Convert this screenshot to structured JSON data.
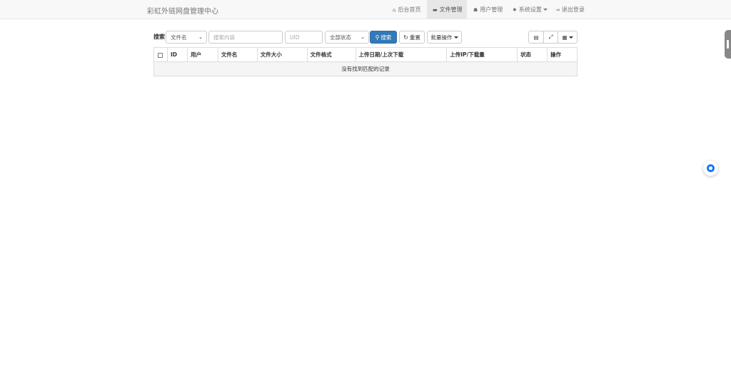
{
  "navbar": {
    "brand": "彩虹外链网盘管理中心",
    "items": [
      {
        "label": "后台首页",
        "icon": "home-icon",
        "active": false
      },
      {
        "label": "文件管理",
        "icon": "folder-icon",
        "active": true
      },
      {
        "label": "用户管理",
        "icon": "users-icon",
        "active": false
      },
      {
        "label": "系统设置",
        "icon": "gear-icon",
        "active": false,
        "dropdown": true
      },
      {
        "label": "退出登录",
        "icon": "sign-out-icon",
        "active": false
      }
    ]
  },
  "toolbar": {
    "search_label": "搜索",
    "field_select": "文件名",
    "keyword_placeholder": "搜索内容",
    "uid_placeholder": "UID",
    "status_select": "全部状态",
    "search_button": "搜索",
    "reset_button": "重置",
    "batch_button": "批量操作"
  },
  "table": {
    "columns": [
      "ID",
      "用户",
      "文件名",
      "文件大小",
      "文件格式",
      "上传日期/上次下载",
      "上传IP/下载量",
      "状态",
      "操作"
    ],
    "empty_message": "没有找到匹配的记录"
  },
  "colors": {
    "primary": "#337ab7",
    "navbar_bg": "#f8f8f8",
    "float_accent": "#1677ff"
  }
}
